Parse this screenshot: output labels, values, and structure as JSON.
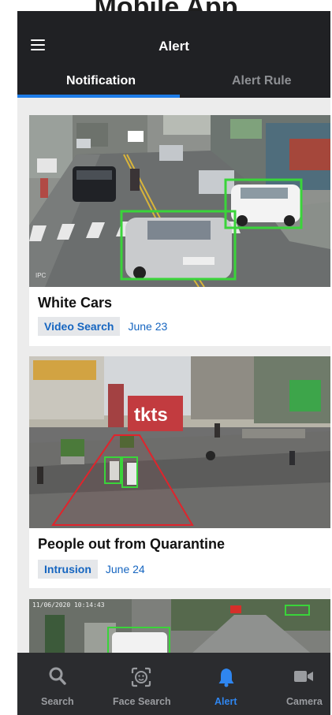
{
  "caption": "Mobile App",
  "header": {
    "title": "Alert"
  },
  "tabs": [
    {
      "label": "Notification",
      "active": true
    },
    {
      "label": "Alert Rule",
      "active": false
    }
  ],
  "cards": [
    {
      "title": "White Cars",
      "tag": "Video Search",
      "date": "June 23",
      "watermark": "IPC"
    },
    {
      "title": "People out from Quarantine",
      "tag": "Intrusion",
      "date": "June 24",
      "sign": "tkts"
    },
    {
      "title": "",
      "tag": "",
      "date": "",
      "timestamp": "11/06/2020 10:14:43"
    }
  ],
  "bottom_nav": [
    {
      "label": "Search",
      "icon": "search-icon",
      "active": false
    },
    {
      "label": "Face Search",
      "icon": "face-scan-icon",
      "active": false
    },
    {
      "label": "Alert",
      "icon": "bell-icon",
      "active": true
    },
    {
      "label": "Camera",
      "icon": "video-camera-icon",
      "active": false
    }
  ],
  "colors": {
    "accent": "#1d7ce8",
    "detection_box": "#3ad43a",
    "intrusion_zone": "#e0242c",
    "appbar": "#202124",
    "nav_bg": "#2b2c2f"
  }
}
